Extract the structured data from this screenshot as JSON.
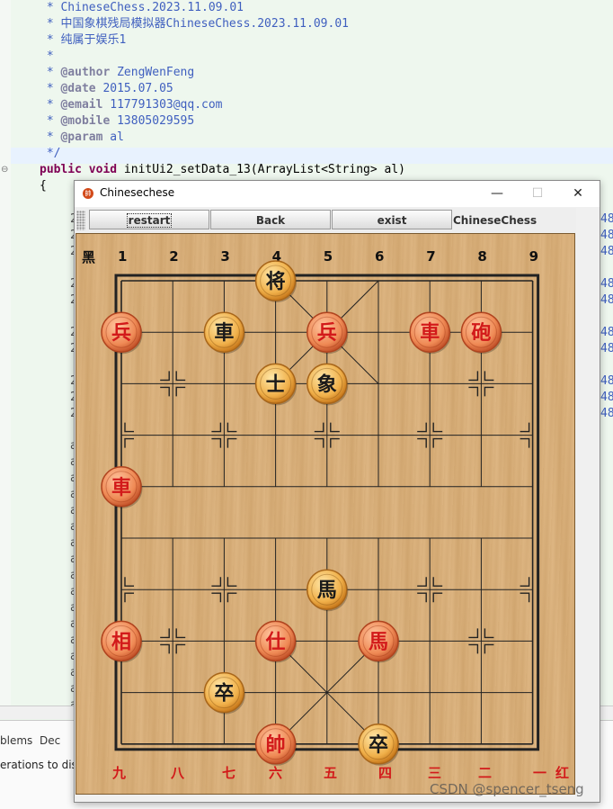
{
  "ide": {
    "comment_lines": [
      " * ChineseChess.2023.11.09.01",
      " * 中国象棋残局模拟器ChineseChess.2023.11.09.01",
      " * 纯属于娱乐1",
      " *",
      " * @author ZengWenFeng",
      " * @date 2015.07.05",
      " * @email 117791303@qq.com",
      " * @mobile 13805029595",
      " * @param al",
      " */"
    ],
    "signature_kw": "public void",
    "signature_rest": " initUi2_setData_13(ArrayList<String> al)",
    "brace": "{",
    "trailing_fragment": "48",
    "leading_fragment_a": "2",
    "leading_fragment_b": "a",
    "tab_problems": "blems",
    "tab_decl": "Dec",
    "console_text": "erations to dis"
  },
  "window": {
    "title": "Chinesechese",
    "icon": "chess-icon",
    "minimize": "—",
    "maximize": "☐",
    "close": "✕"
  },
  "toolbar": {
    "restart_label": "restart",
    "back_label": "Back",
    "exit_label": "exist",
    "app_label": "ChineseChess"
  },
  "board": {
    "black_side_label": "黑",
    "red_side_label": "红",
    "top_numbers": [
      "1",
      "2",
      "3",
      "4",
      "5",
      "6",
      "7",
      "8",
      "9"
    ],
    "bottom_numbers": [
      "九",
      "八",
      "七",
      "六",
      "五",
      "四",
      "三",
      "二",
      "一"
    ],
    "colors": {
      "black_text": "#1a1a1a",
      "red_text": "#d21a1a",
      "grid": "#222222"
    },
    "pieces": [
      {
        "char": "将",
        "color": "black",
        "file": 4,
        "rank": 0
      },
      {
        "char": "兵",
        "color": "red",
        "file": 1,
        "rank": 1
      },
      {
        "char": "車",
        "color": "black",
        "file": 3,
        "rank": 1
      },
      {
        "char": "兵",
        "color": "red",
        "file": 5,
        "rank": 1
      },
      {
        "char": "車",
        "color": "red",
        "file": 7,
        "rank": 1
      },
      {
        "char": "砲",
        "color": "red",
        "file": 8,
        "rank": 1
      },
      {
        "char": "士",
        "color": "black",
        "file": 4,
        "rank": 2
      },
      {
        "char": "象",
        "color": "black",
        "file": 5,
        "rank": 2
      },
      {
        "char": "車",
        "color": "red",
        "file": 1,
        "rank": 4
      },
      {
        "char": "馬",
        "color": "black",
        "file": 5,
        "rank": 6
      },
      {
        "char": "相",
        "color": "red",
        "file": 1,
        "rank": 7
      },
      {
        "char": "仕",
        "color": "red",
        "file": 4,
        "rank": 7
      },
      {
        "char": "馬",
        "color": "red",
        "file": 6,
        "rank": 7
      },
      {
        "char": "卒",
        "color": "black",
        "file": 3,
        "rank": 8
      },
      {
        "char": "帥",
        "color": "red",
        "file": 4,
        "rank": 9
      },
      {
        "char": "卒",
        "color": "black",
        "file": 6,
        "rank": 9
      }
    ]
  },
  "watermark": "CSDN @spencer_tseng"
}
